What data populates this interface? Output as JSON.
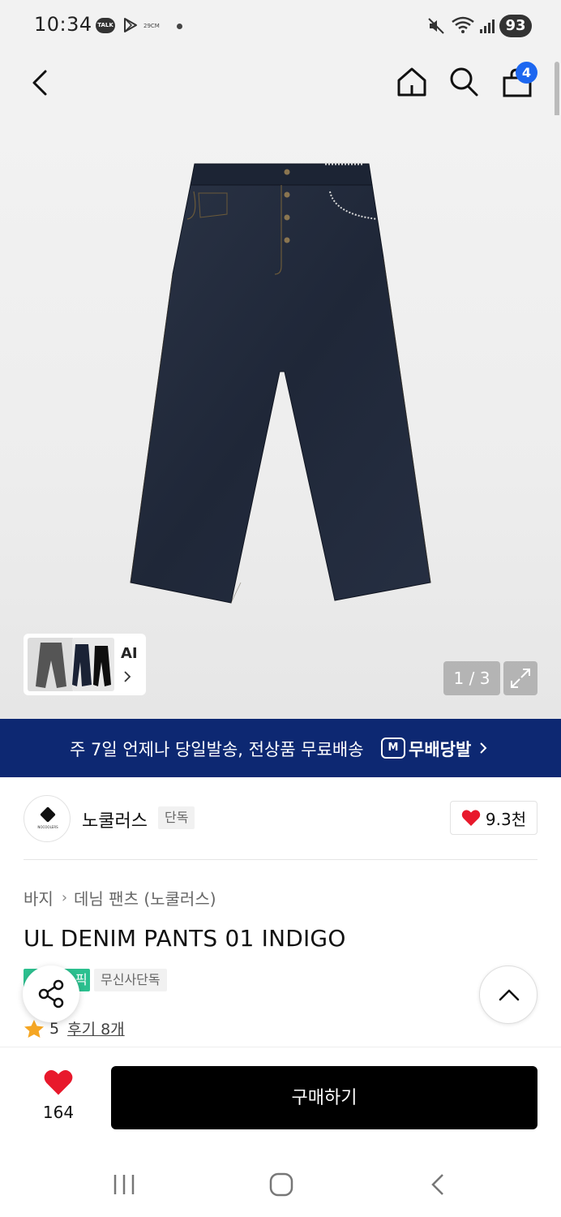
{
  "status_bar": {
    "time": "10:34",
    "talk_label": "TALK",
    "cm_label": "29CM",
    "battery": "93"
  },
  "header": {
    "cart_count": "4",
    "icons": [
      "back-icon",
      "home-icon",
      "search-icon",
      "shopping-bag-icon"
    ]
  },
  "gallery": {
    "ai_label": "AI",
    "page_indicator": "1 / 3"
  },
  "banner": {
    "text": "주 7일 언제나 당일발송, 전상품 무료배송",
    "brand": "무배당발",
    "logo_letter": "M"
  },
  "brand": {
    "name": "노쿨러스",
    "exclusive_tag": "단독",
    "like_count": "9.3천",
    "logo_text": "NOCOOLERS"
  },
  "product": {
    "breadcrumb": [
      "바지",
      "데님 팬츠 (노쿨러스)"
    ],
    "title": "UL DENIM PANTS 01 INDIGO",
    "tag_green": "픽",
    "tag_gray": "무신사단독",
    "rating": "5",
    "reviews": "후기 8개"
  },
  "bottom_bar": {
    "like_count": "164",
    "buy_label": "구매하기"
  },
  "colors": {
    "banner_bg": "#0d2872",
    "badge_blue": "#1d67f0",
    "heart_red": "#e8192c",
    "tag_green": "#2cc08f",
    "star": "#f5a623"
  }
}
